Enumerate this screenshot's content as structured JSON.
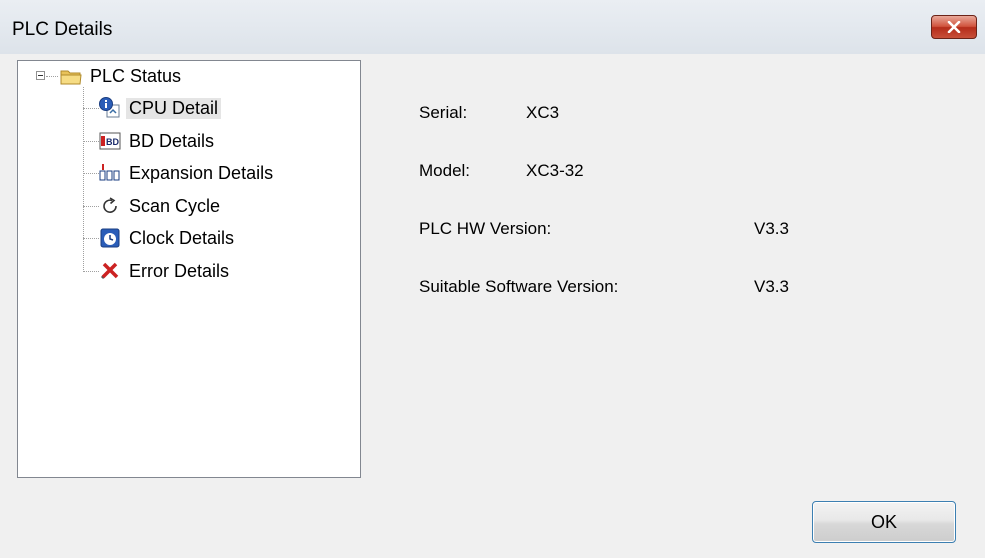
{
  "window": {
    "title": "PLC Details"
  },
  "tree": {
    "root": {
      "label": "PLC Status",
      "icon": "folder-icon"
    },
    "children": [
      {
        "label": "CPU Detail",
        "icon": "cpu-info-icon",
        "selected": true
      },
      {
        "label": "BD Details",
        "icon": "bd-board-icon",
        "selected": false
      },
      {
        "label": "Expansion Details",
        "icon": "expansion-module-icon",
        "selected": false
      },
      {
        "label": "Scan Cycle",
        "icon": "refresh-cycle-icon",
        "selected": false
      },
      {
        "label": "Clock Details",
        "icon": "clock-icon",
        "selected": false
      },
      {
        "label": "Error Details",
        "icon": "error-tools-icon",
        "selected": false
      }
    ]
  },
  "details": {
    "serial_label": "Serial:",
    "serial_value": "XC3",
    "model_label": "Model:",
    "model_value": "XC3-32",
    "hw_label": "PLC HW Version:",
    "hw_value": "V3.3",
    "sw_label": "Suitable Software Version:",
    "sw_value": "V3.3"
  },
  "buttons": {
    "ok_label": "OK",
    "close_label": "×"
  },
  "colors": {
    "title_bar": "#dde3ea",
    "close_button": "#c8503a",
    "selection": "#e5e5e5",
    "dialog_bg": "#f0f0f0"
  }
}
